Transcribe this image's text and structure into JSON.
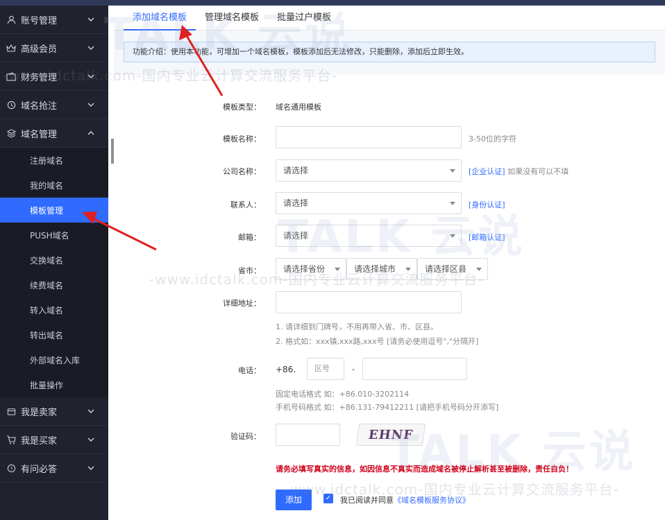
{
  "sidebar": {
    "menus": [
      {
        "label": "账号管理",
        "icon": "user-icon"
      },
      {
        "label": "高级会员",
        "icon": "crown-icon"
      },
      {
        "label": "财务管理",
        "icon": "wallet-icon"
      },
      {
        "label": "域名抢注",
        "icon": "clock-icon"
      },
      {
        "label": "域名管理",
        "icon": "layers-icon"
      }
    ],
    "submenu": [
      {
        "label": "注册域名"
      },
      {
        "label": "我的域名"
      },
      {
        "label": "模板管理"
      },
      {
        "label": "PUSH域名"
      },
      {
        "label": "交换域名"
      },
      {
        "label": "续费域名"
      },
      {
        "label": "转入域名"
      },
      {
        "label": "转出域名"
      },
      {
        "label": "外部域名入库"
      },
      {
        "label": "批量操作"
      }
    ],
    "bottom_menus": [
      {
        "label": "我是卖家",
        "icon": "shop-icon"
      },
      {
        "label": "我是买家",
        "icon": "cart-icon"
      },
      {
        "label": "有问必答",
        "icon": "question-icon"
      }
    ]
  },
  "tabs": [
    {
      "label": "添加域名模板"
    },
    {
      "label": "管理域名模板"
    },
    {
      "label": "批量过户模板"
    }
  ],
  "notice": "功能介绍：使用本功能，可增加一个域名模板，模板添加后无法修改，只能删除，添加后立即生效。",
  "form": {
    "template_type_label": "模板类型：",
    "template_type_value": "域名通用模板",
    "template_name_label": "模板名称：",
    "template_name_hint": "3-50位的字符",
    "company_label": "公司名称：",
    "company_placeholder": "请选择",
    "company_link": "[企业认证]",
    "company_hint": "如果没有可以不填",
    "contact_label": "联系人：",
    "contact_placeholder": "请选择",
    "contact_link": "[身份认证]",
    "email_label": "邮箱：",
    "email_placeholder": "请选择",
    "email_link": "[邮箱认证]",
    "province_label": "省市：",
    "province_placeholder": "请选择省份",
    "city_placeholder": "请选择城市",
    "district_placeholder": "请选择区县",
    "address_label": "详细地址：",
    "address_hint1": "1. 请详细到门牌号，不用再带入省、市、区县。",
    "address_hint2": "2. 格式如：xxx镇,xxx路,xxx号 [请务必使用逗号\",\"分隔开]",
    "phone_label": "电话：",
    "phone_prefix": "+86.",
    "area_code_placeholder": "区号",
    "phone_dash": "-",
    "phone_hint1": "固定电话格式 如：+86.010-3202114",
    "phone_hint2": "手机号码格式 如：+86.131-79412211 [请把手机号码分开添写]",
    "captcha_label": "验证码：",
    "captcha_text": "EHNF",
    "warning": "请务必填写真实的信息，如因信息不真实而造成域名被停止解析甚至被删除，责任自负！",
    "submit_label": "添加",
    "agree_text": "我已阅读并同意",
    "agreement_link": "《域名模板服务协议》"
  },
  "watermark": {
    "brand_big": "TALK 云说",
    "url_text": "-www.idctalk.com-国内专业云计算交流服务平台-"
  },
  "colors": {
    "accent": "#2f6bff",
    "sidebar_bg": "#20232e",
    "warning": "#d0021b"
  }
}
